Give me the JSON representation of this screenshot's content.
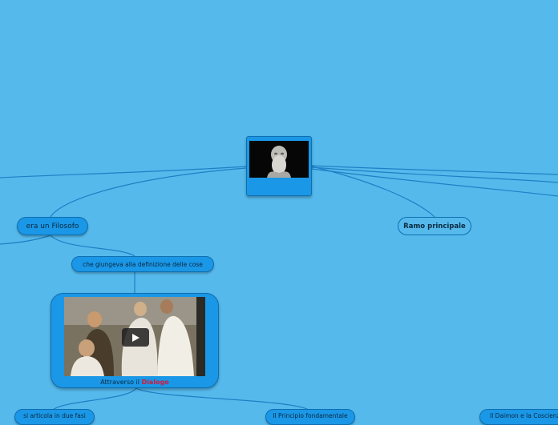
{
  "mindmap": {
    "root": {
      "image_description_icon": "socrates-bust-photo"
    },
    "nodes": {
      "filosofo": "era un Filosofo",
      "ramo": "Ramo principale",
      "definizione": "che giungeva alla definizione delle cose",
      "dialogo_prefix": "Attraverso il",
      "dialogo_highlight": "Dialogo",
      "fasi": "si articola in due fasi",
      "ignoranza": "Il Principio fondamentale",
      "bottom_right": "Il Daimon e la Coscienza"
    },
    "video": {
      "icon": "play-icon"
    }
  },
  "colors": {
    "background": "#55b9ec",
    "node_fill": "#1a97e6",
    "node_border": "#0f6fb0",
    "line": "#1f7fc4",
    "highlight": "#d1193d"
  }
}
